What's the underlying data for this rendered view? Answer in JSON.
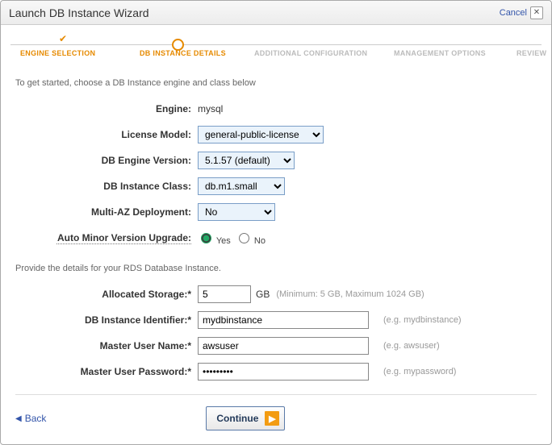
{
  "header": {
    "title": "Launch DB Instance Wizard",
    "cancel": "Cancel"
  },
  "steps": {
    "s1": "ENGINE SELECTION",
    "s2": "DB INSTANCE DETAILS",
    "s3": "ADDITIONAL CONFIGURATION",
    "s4": "MANAGEMENT OPTIONS",
    "s5": "REVIEW"
  },
  "intro": "To get started, choose a DB Instance engine and class below",
  "labels": {
    "engine": "Engine:",
    "license": "License Model:",
    "version": "DB Engine Version:",
    "class": "DB Instance Class:",
    "multiaz": "Multi-AZ Deployment:",
    "autominor": "Auto Minor Version Upgrade:",
    "storage": "Allocated Storage:*",
    "identifier": "DB Instance Identifier:*",
    "user": "Master User Name:*",
    "pass": "Master User Password:*"
  },
  "values": {
    "engine": "mysql",
    "license": "general-public-license",
    "version": "5.1.57 (default)",
    "class": "db.m1.small",
    "multiaz": "No",
    "yes": "Yes",
    "no": "No",
    "storage": "5",
    "gb": "GB",
    "storage_hint": "(Minimum: 5 GB, Maximum 1024 GB)",
    "identifier": "mydbinstance",
    "identifier_hint": "(e.g. mydbinstance)",
    "user": "awsuser",
    "user_hint": "(e.g. awsuser)",
    "pass": "•••••••••",
    "pass_hint": "(e.g. mypassword)"
  },
  "section2": "Provide the details for your RDS Database Instance.",
  "footer": {
    "back": "Back",
    "continue": "Continue"
  }
}
